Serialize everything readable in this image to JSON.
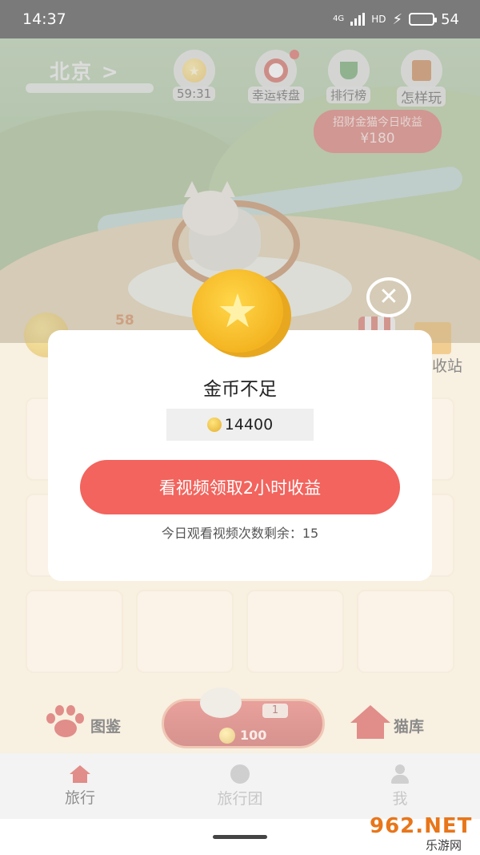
{
  "status_bar": {
    "time": "14:37",
    "network": "4G",
    "hd": "HD",
    "battery": "54",
    "battery_level": 0.54
  },
  "header": {
    "city": "北京 >",
    "timer": "59:31",
    "lucky_wheel": "幸运转盘",
    "ranking": "排行榜",
    "how_to_play": "怎样玩",
    "income_label": "招财金猫今日收益",
    "income_amount": "¥180"
  },
  "scene": {
    "count_badge": "58",
    "station_label": "收站"
  },
  "bottom_bar": {
    "guide_label": "图鉴",
    "buy_badge": "1",
    "buy_price": "100",
    "library_label": "猫库"
  },
  "tabs": [
    {
      "label": "旅行",
      "active": true
    },
    {
      "label": "旅行团",
      "active": false
    },
    {
      "label": "我",
      "active": false
    }
  ],
  "dialog": {
    "title": "金币不足",
    "coins": "14400",
    "watch_button": "看视频领取2小时收益",
    "remaining": "今日观看视频次数剩余：15",
    "close_symbol": "✕"
  },
  "watermark": {
    "top": "962.NET",
    "bottom": "乐游网"
  },
  "colors": {
    "accent": "#f2645d",
    "income_bg": "#cf4f44",
    "brand_red": "#c9302b"
  }
}
